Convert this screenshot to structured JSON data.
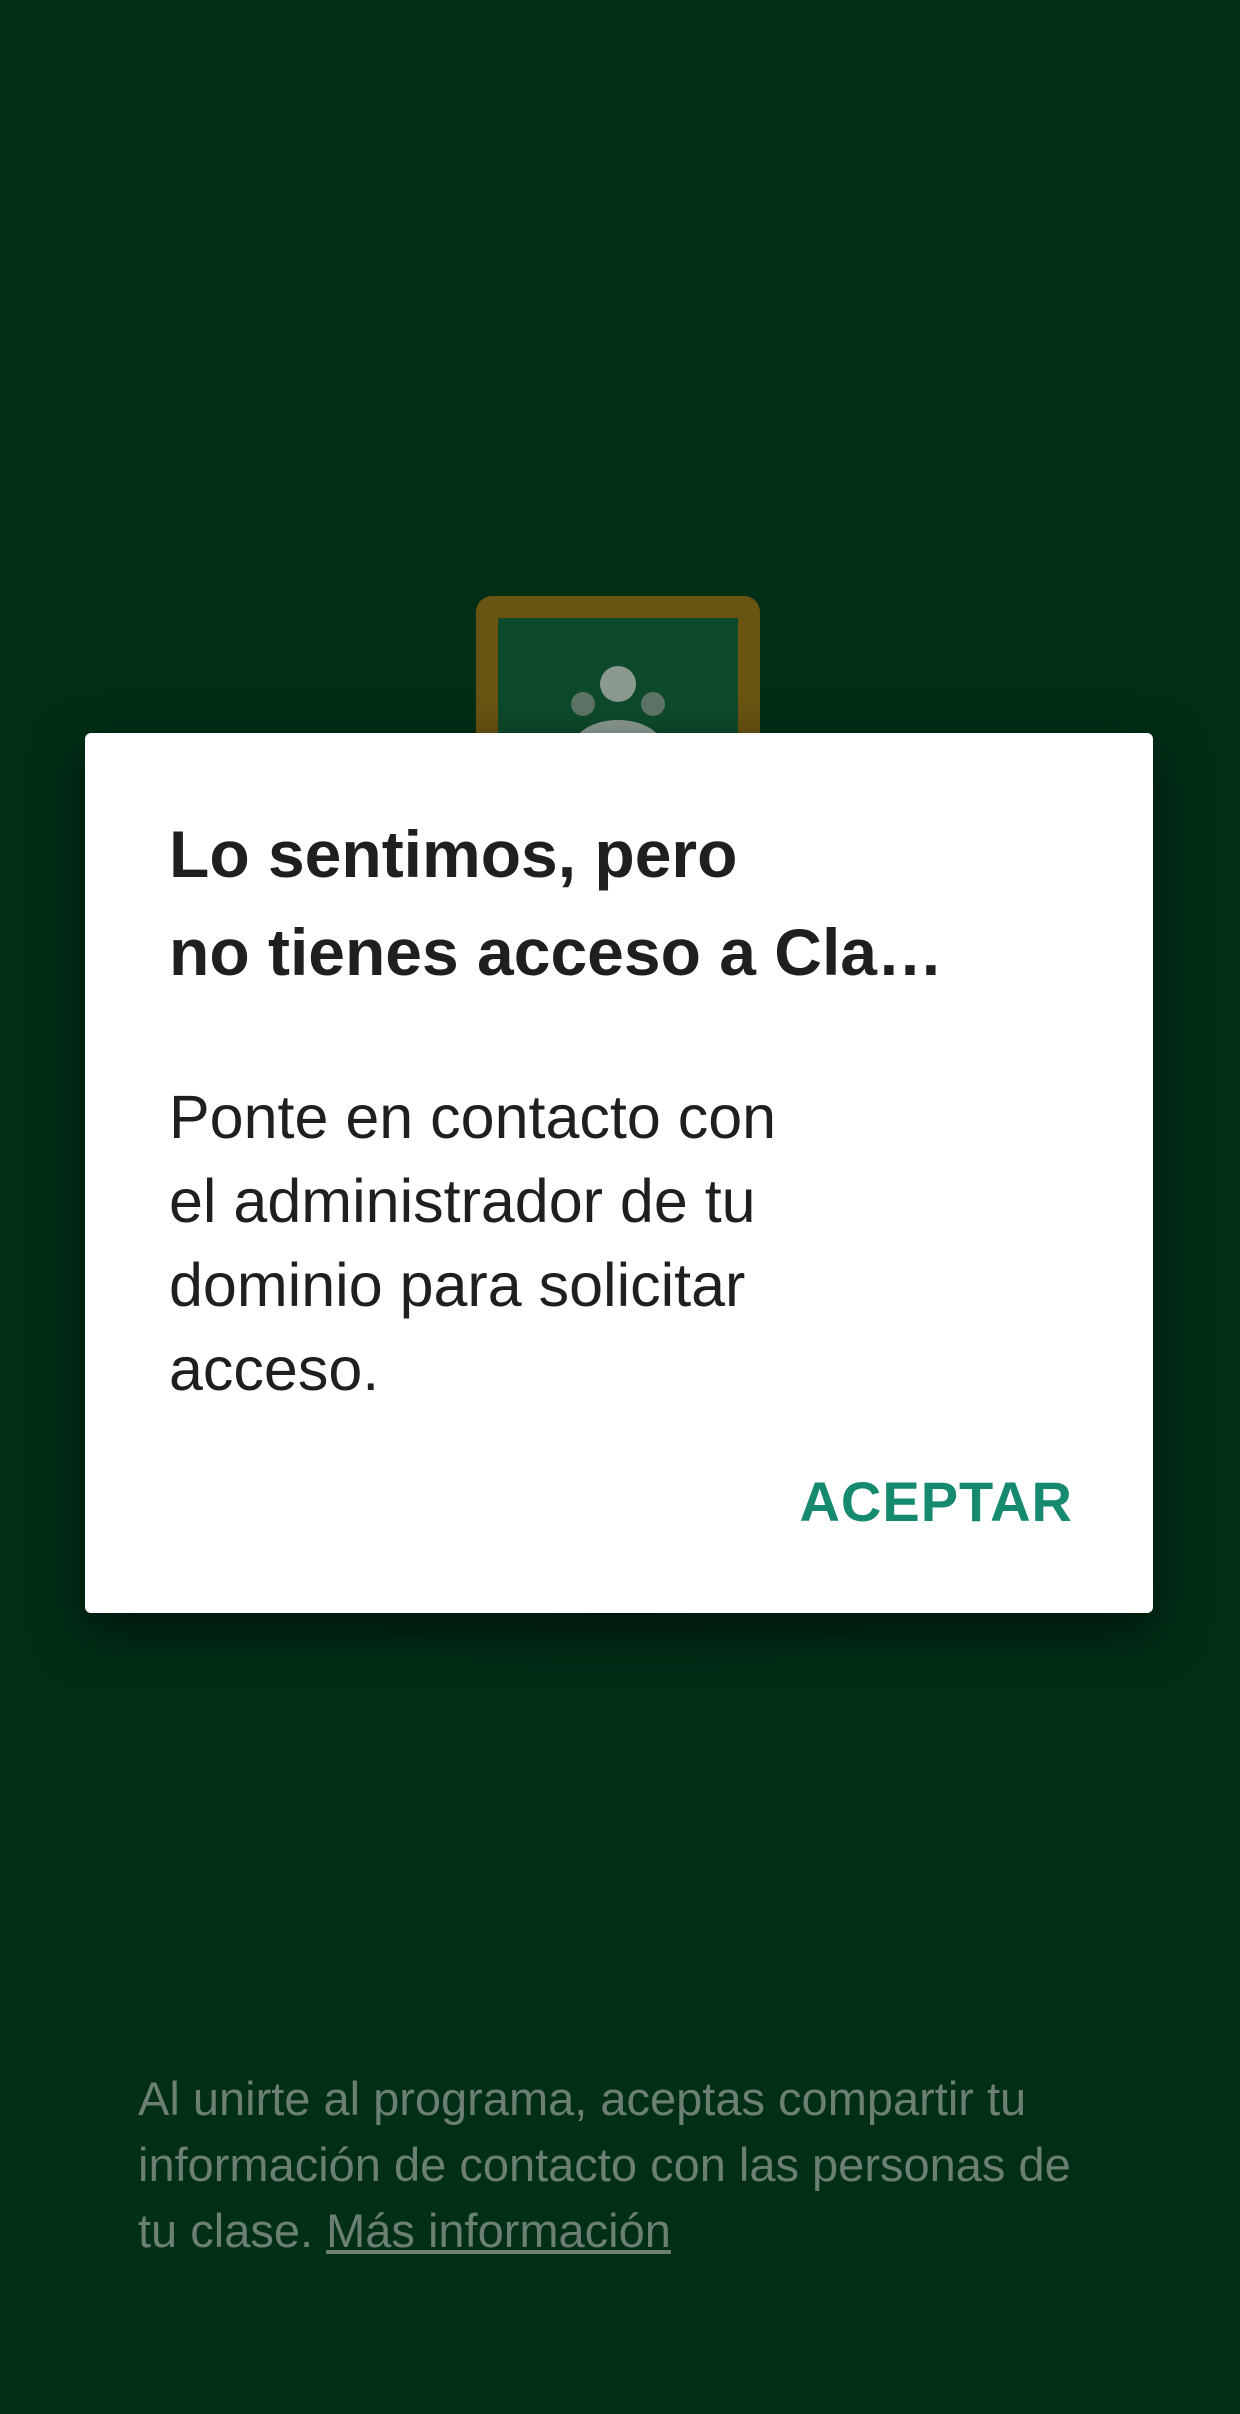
{
  "colors": {
    "background": "#002e17",
    "logo_border": "#6a5412",
    "logo_fill": "#0d4a2c",
    "dialog_background": "#ffffff",
    "dialog_text": "#1f1f1f",
    "accent": "#168a6e",
    "footer_text": "#6b7f72"
  },
  "logo": {
    "icon": "classroom-logo-icon"
  },
  "dialog": {
    "title": "Lo sentimos, pero\nno tienes acceso a Cla…",
    "body": "Ponte en contacto con\nel administrador de tu\ndominio para solicitar\nacceso.",
    "accept_label": "ACEPTAR"
  },
  "footer": {
    "text": "Al unirte al programa, aceptas compartir tu información de contacto con las personas de tu clase.",
    "link_label": "Más información"
  }
}
